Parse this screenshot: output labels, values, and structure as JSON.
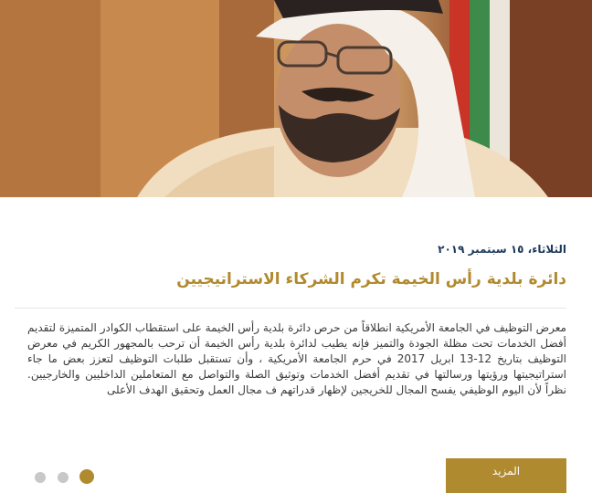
{
  "hero": {
    "image_alt": "portrait"
  },
  "article": {
    "date": "الثلاثاء، ١٥ سبتمبر ٢٠١٩",
    "title": "دائرة بلدية رأس الخيمة تكرم الشركاء الاستراتيجيين",
    "body": "معرض التوظيف في الجامعة الأمريكية انطلاقاً من حرص دائرة بلدية رأس الخيمة على استقطاب الكوادر المتميزة لتقديم أفضل الخدمات تحت مظلة الجودة والتميز فإنه يطيب لدائرة بلدية رأس الخيمة أن ترحب بالمجهور الكريم في معرض التوظيف بتاريخ 12-13 ابريل 2017 في حرم الجامعة الأمريكية ،  وأن تستقبل طلبات التوظيف لتعزز بعض ما جاء استراتيجيتها ورؤيتها ورسالتها في تقديم أفضل الخدمات وتوثيق الصلة والتواصل مع المتعاملين الداخليين والخارجيين. نظراً لأن اليوم الوظيفي يفسح المجال للخريجين لإظهار قدراتهم ف مجال العمل وتحقيق الهدف الأعلى",
    "more_label": "المزيد"
  },
  "carousel": {
    "total": 3,
    "active_index": 2,
    "active_color": "#b08a2e",
    "inactive_color": "#c8c8c8"
  },
  "colors": {
    "accent": "#b08a2e",
    "date_text": "#1d3a5a",
    "body_text": "#3b3b3b"
  }
}
